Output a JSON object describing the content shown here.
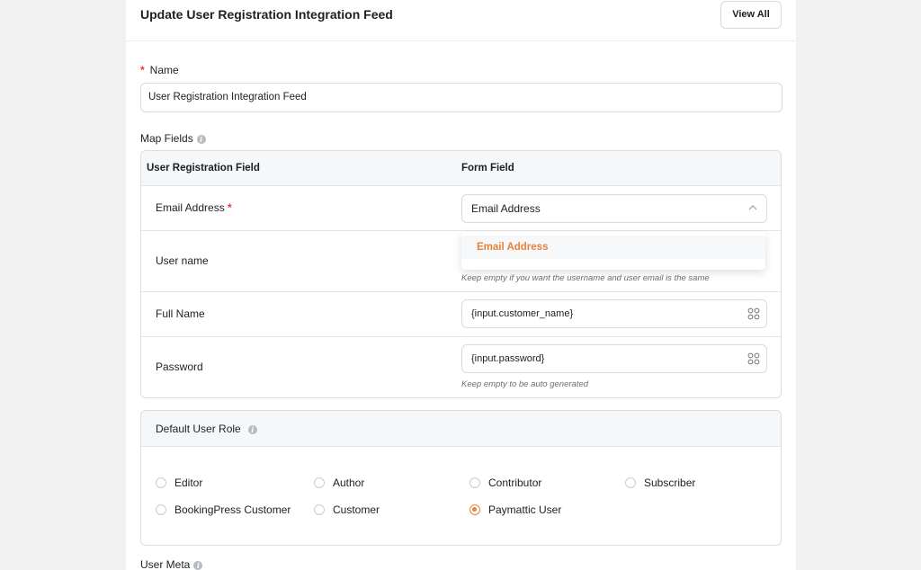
{
  "header": {
    "title": "Update User Registration Integration Feed",
    "view_all": "View All"
  },
  "name_field": {
    "required_mark": "*",
    "label": "Name",
    "value": "User Registration Integration Feed"
  },
  "map_fields": {
    "label": "Map Fields",
    "col1": "User Registration Field",
    "col2": "Form Field",
    "rows": [
      {
        "label": "Email Address",
        "required_mark": "*",
        "value": "Email Address"
      },
      {
        "label": "User name",
        "hint": "Keep empty if you want the username and user email is the same"
      },
      {
        "label": "Full Name",
        "value": "{input.customer_name}"
      },
      {
        "label": "Password",
        "value": "{input.password}",
        "hint": "Keep empty to be auto generated"
      }
    ],
    "dropdown_option": "Email Address"
  },
  "default_role": {
    "title": "Default User Role",
    "options": [
      "Editor",
      "Author",
      "Contributor",
      "Subscriber",
      "BookingPress Customer",
      "Customer",
      "Paymattic User"
    ],
    "selected": "Paymattic User"
  },
  "user_meta": {
    "label": "User Meta"
  },
  "colors": {
    "accent": "#e8823a",
    "required": "#e33333",
    "border": "#d6dae1",
    "header_bg": "#f6f7f8"
  },
  "icons": {
    "info": "info-icon",
    "chevron": "chevron-up-icon",
    "shortcode": "grid-icon"
  }
}
